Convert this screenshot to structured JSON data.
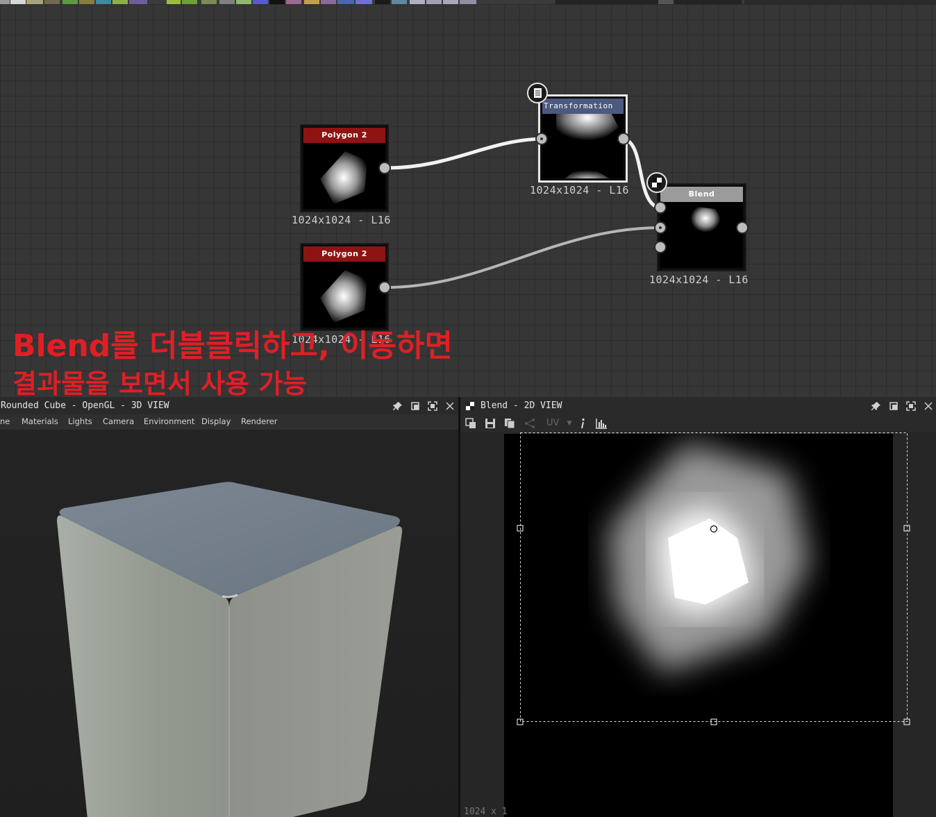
{
  "annotation": {
    "line1": "Blend를 더블클릭하고, 이동하면",
    "line2": "결과물을 보면서 사용 가능",
    "color": "#e01f25"
  },
  "graph": {
    "nodes": [
      {
        "id": "polygon_top",
        "title": "Polygon 2",
        "caption": "1024x1024 - L16"
      },
      {
        "id": "polygon_bottom",
        "title": "Polygon 2",
        "caption": "1024x1024 - L16"
      },
      {
        "id": "transformation",
        "title": "Transformation ···",
        "caption": "1024x1024 - L16"
      },
      {
        "id": "blend",
        "title": "Blend",
        "caption": "1024x1024 - L16"
      }
    ]
  },
  "panel3d": {
    "title": "Rounded Cube - OpenGL - 3D VIEW",
    "menu": [
      "ne",
      "Materials",
      "Lights",
      "Camera",
      "Environment",
      "Display",
      "Renderer"
    ]
  },
  "panel2d": {
    "title": "Blend - 2D VIEW",
    "uv_label": "UV",
    "size_readout": "1024 x 1"
  },
  "icons": {
    "pin": "pin-icon",
    "restore": "restore-icon",
    "maximize": "maximize-icon",
    "close": "close-icon"
  }
}
